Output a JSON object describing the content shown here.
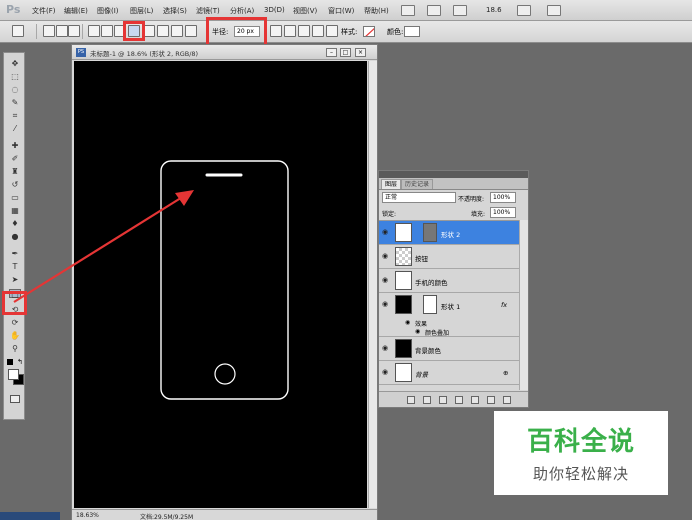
{
  "app": {
    "logo": "Ps"
  },
  "menu": [
    "文件(F)",
    "编辑(E)",
    "图像(I)",
    "图层(L)",
    "选择(S)",
    "滤镜(T)",
    "分析(A)",
    "3D(D)",
    "视图(V)",
    "窗口(W)",
    "帮助(H)"
  ],
  "menubar_right": {
    "zoom": "18.6"
  },
  "options": {
    "radius_label": "半径:",
    "radius_value": "20 px",
    "style_label": "样式:",
    "color_label": "颜色:"
  },
  "document": {
    "title": "未标题-1 @ 18.6% (形状 2, RGB/8)",
    "icon": "PS",
    "zoom_status": "18.63%",
    "doc_status": "文档:29.5M/9.25M"
  },
  "layers_panel": {
    "tabs": [
      "图层",
      "历史记录"
    ],
    "blend_mode": "正常",
    "opacity_label": "不透明度:",
    "opacity_value": "100%",
    "lock_label": "锁定:",
    "fill_label": "填充:",
    "fill_value": "100%",
    "layers": [
      {
        "name": "形状 2",
        "selected": true,
        "fx": false
      },
      {
        "name": "按钮",
        "selected": false,
        "fx": false
      },
      {
        "name": "手机的颜色",
        "selected": false,
        "fx": false
      },
      {
        "name": "形状 1",
        "selected": false,
        "fx": true
      },
      {
        "name": "背景颜色",
        "selected": false,
        "fx": false
      },
      {
        "name": "背景",
        "selected": false,
        "fx": false
      }
    ],
    "effects_label": "效果",
    "effect_item": "颜色叠加",
    "fx_badge": "fx"
  },
  "watermark": {
    "title": "百科全说",
    "subtitle": "助你轻松解决"
  },
  "colors": {
    "highlight": "#e53535",
    "selection": "#3d82e0",
    "canvas": "#000000",
    "accent_green": "#3ab04a"
  }
}
